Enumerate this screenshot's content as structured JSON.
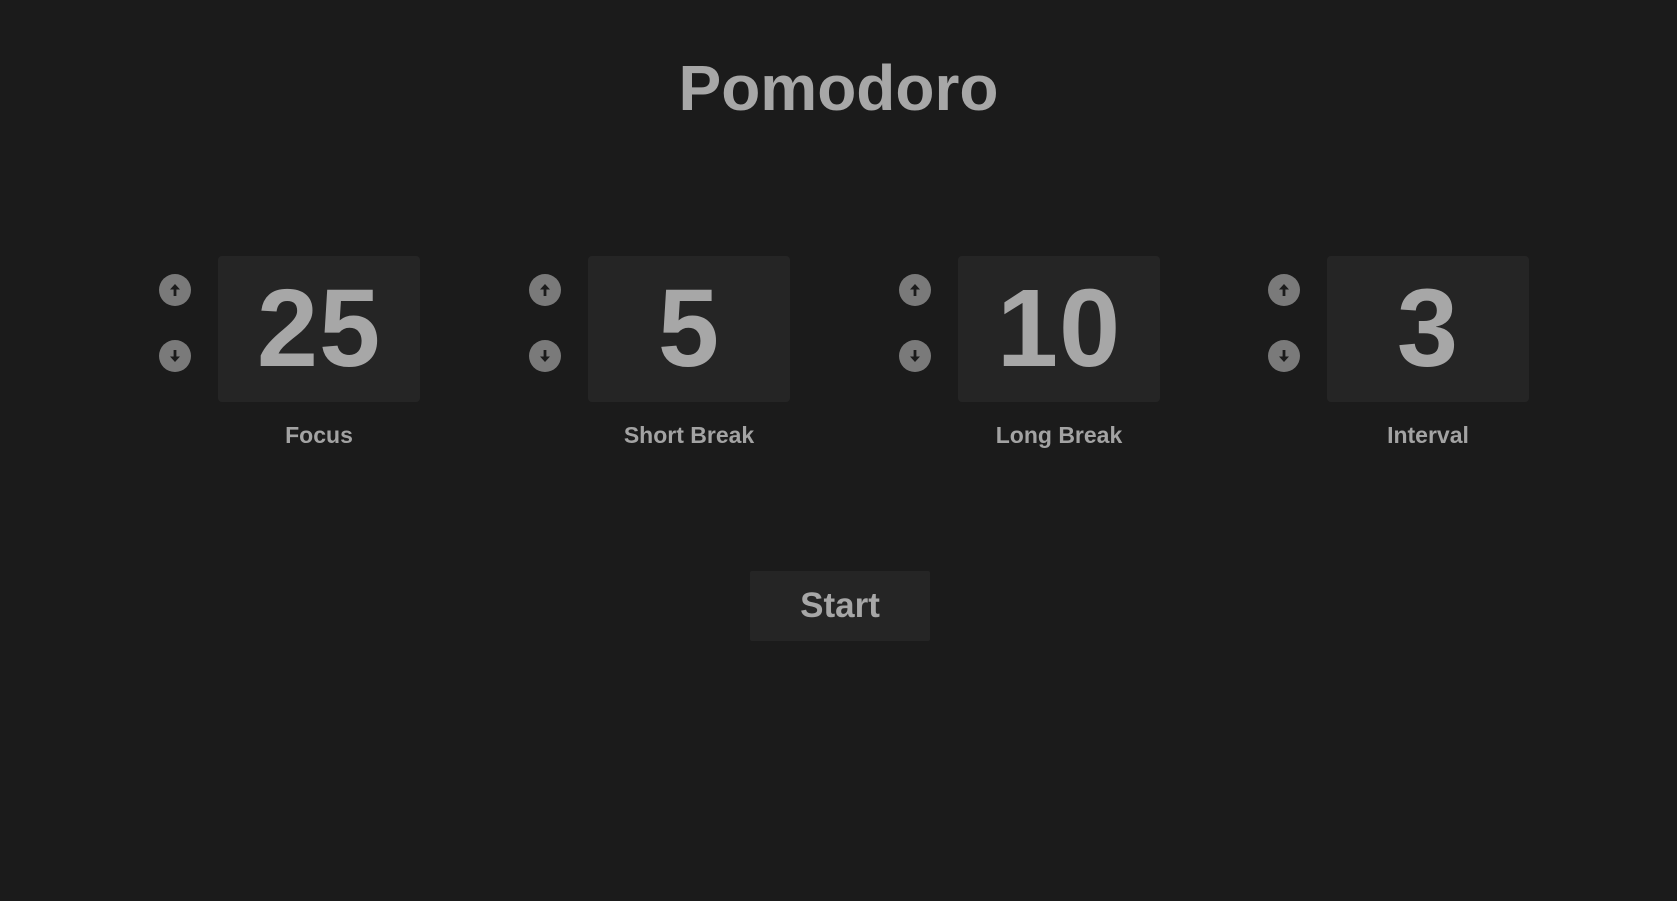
{
  "app": {
    "title": "Pomodoro"
  },
  "timers": [
    {
      "id": "focus",
      "value": "25",
      "label": "Focus"
    },
    {
      "id": "short-break",
      "value": "5",
      "label": "Short Break"
    },
    {
      "id": "long-break",
      "value": "10",
      "label": "Long Break"
    },
    {
      "id": "interval",
      "value": "3",
      "label": "Interval"
    }
  ],
  "controls": {
    "increment_icon": "arrow-up-circle-icon",
    "decrement_icon": "arrow-down-circle-icon",
    "start_label": "Start"
  },
  "colors": {
    "background": "#1b1b1b",
    "panel": "#252525",
    "text": "#a7a7a7",
    "stepper": "#7a7a7a"
  }
}
